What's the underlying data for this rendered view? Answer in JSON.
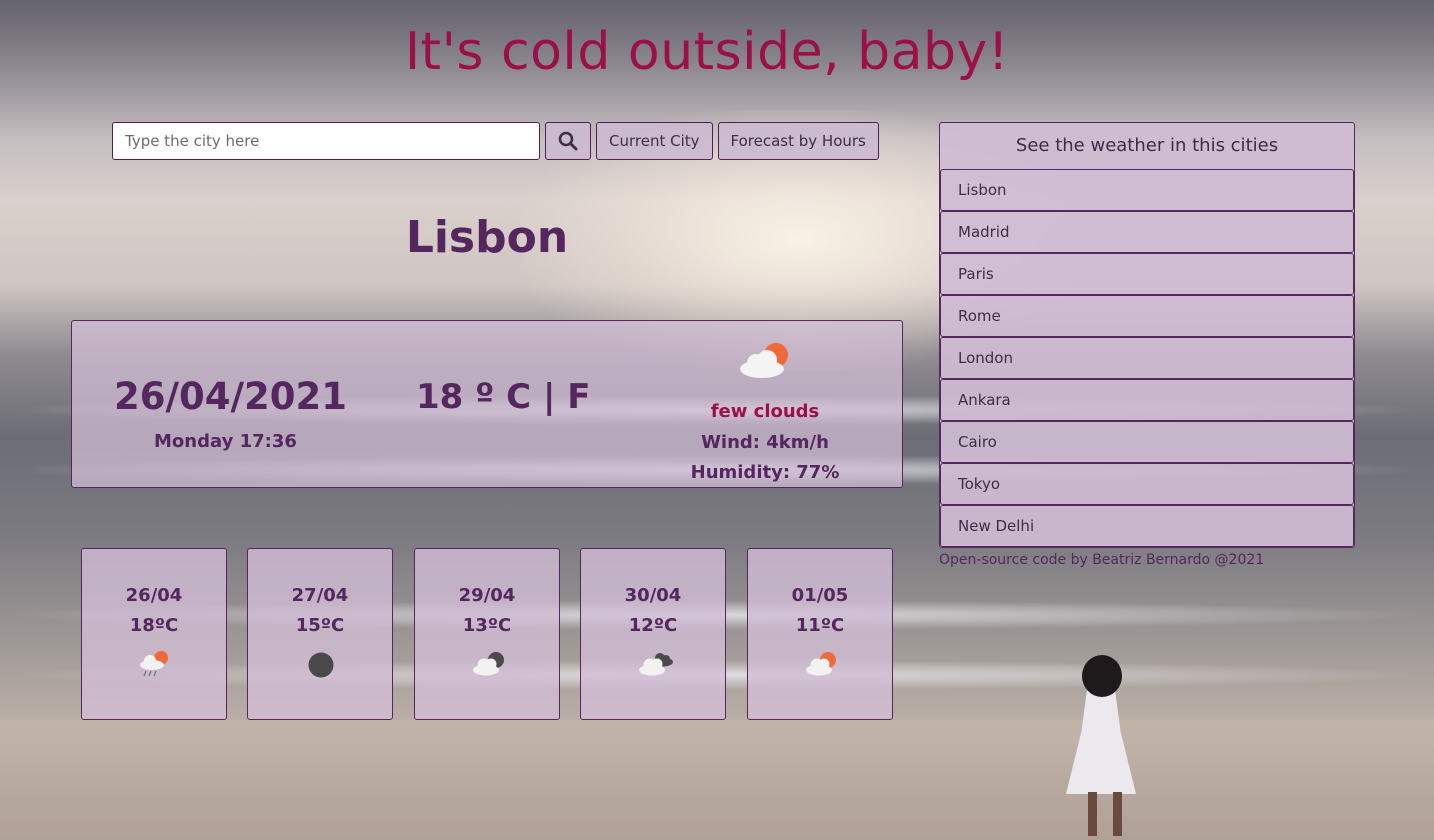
{
  "app": {
    "title": "It's cold outside, baby!"
  },
  "search": {
    "placeholder": "Type the city here",
    "value": "",
    "search_icon": "search-icon",
    "current_city_label": "Current City",
    "forecast_label": "Forecast by Hours"
  },
  "current": {
    "city": "Lisbon",
    "date": "26/04/2021",
    "day_time": "Monday 17:36",
    "temperature": "18 º C | F",
    "description": "few clouds",
    "wind": "Wind: 4km/h",
    "humidity": "Humidity: 77%",
    "icon": "few-clouds-day-icon"
  },
  "forecast": [
    {
      "date": "26/04",
      "temp": "18ºC",
      "icon": "rain-sun-icon"
    },
    {
      "date": "27/04",
      "temp": "15ºC",
      "icon": "clear-night-icon"
    },
    {
      "date": "29/04",
      "temp": "13ºC",
      "icon": "cloud-moon-icon"
    },
    {
      "date": "30/04",
      "temp": "12ºC",
      "icon": "broken-clouds-icon"
    },
    {
      "date": "01/05",
      "temp": "11ºC",
      "icon": "few-clouds-day-icon"
    }
  ],
  "cities": {
    "header": "See the weather in this cities",
    "items": [
      "Lisbon",
      "Madrid",
      "Paris",
      "Rome",
      "London",
      "Ankara",
      "Cairo",
      "Tokyo",
      "New Delhi"
    ]
  },
  "footer": {
    "text": "Open-source code by Beatriz Bernardo @2021"
  },
  "colors": {
    "title": "#9b1048",
    "accent": "#54275e",
    "panel": "#d2bed6",
    "sun": "#ef6a3a"
  }
}
